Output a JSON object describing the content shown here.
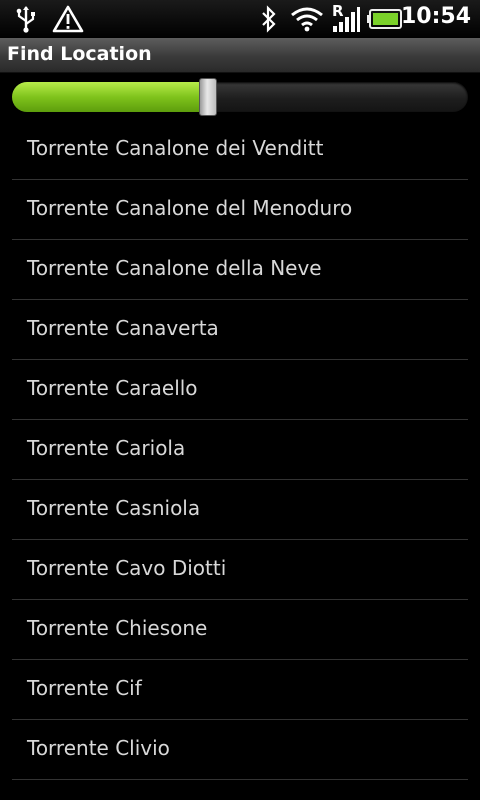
{
  "status_bar": {
    "time": "10:54",
    "icons": [
      "usb-icon",
      "warning-icon",
      "bluetooth-icon",
      "wifi-icon",
      "signal-roaming-icon",
      "battery-icon"
    ],
    "battery_color": "#7bd12a"
  },
  "header": {
    "title": "Find Location"
  },
  "zoom_slider": {
    "value_fraction": 0.43,
    "fill_color": "#8fd323"
  },
  "locations": [
    "Torrente Canalone dei Venditt",
    "Torrente Canalone del Menoduro",
    "Torrente Canalone della Neve",
    "Torrente Canaverta",
    "Torrente Caraello",
    "Torrente Cariola",
    "Torrente Casniola",
    "Torrente Cavo Diotti",
    "Torrente Chiesone",
    "Torrente Cif",
    "Torrente Clivio"
  ]
}
